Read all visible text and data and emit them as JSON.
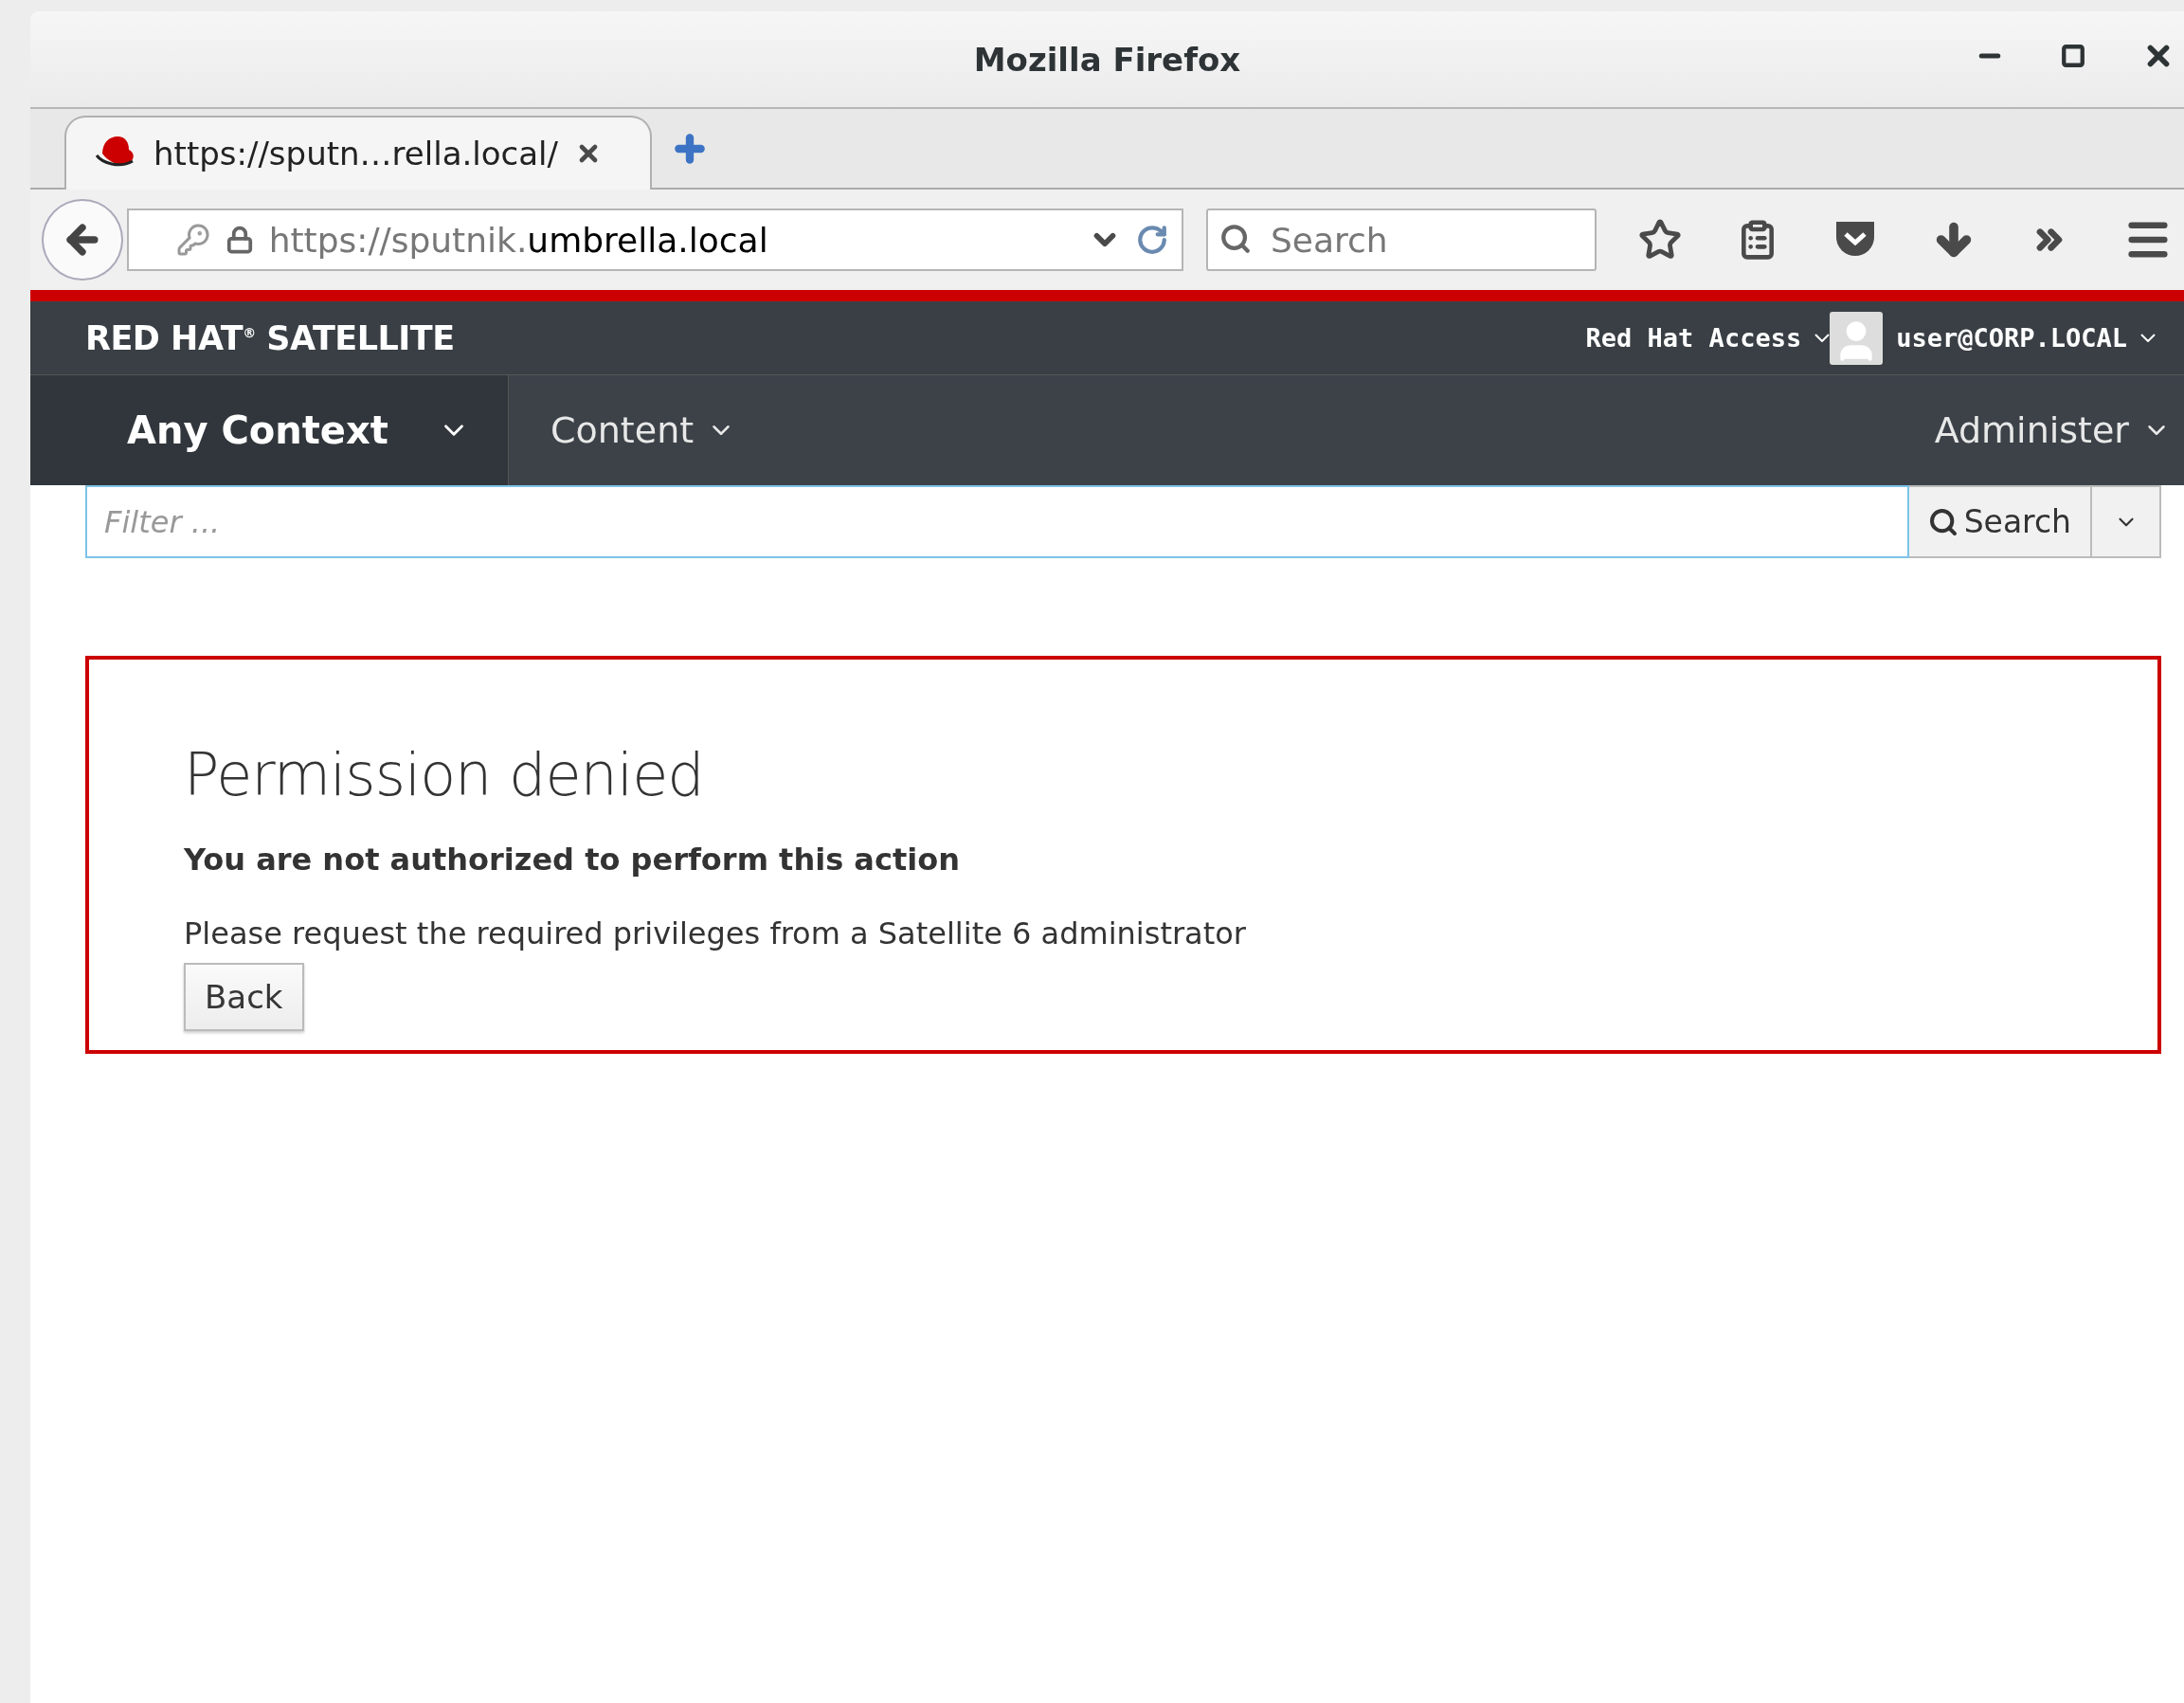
{
  "window": {
    "title": "Mozilla Firefox"
  },
  "tabs": [
    {
      "label": "https://sputn…rella.local/",
      "selected": true
    }
  ],
  "address_bar": {
    "prefix": "https://sputnik.",
    "host": "umbrella.local"
  },
  "browser_search": {
    "placeholder": "Search"
  },
  "header": {
    "brand": "RED HAT$^{®}$ SATELLITE",
    "help_menu": "Red Hat Access",
    "user_menu": "user@CORP.LOCAL"
  },
  "nav": {
    "context": "Any Context",
    "left_items": [
      "Content"
    ],
    "right_items": [
      "Administer"
    ]
  },
  "filter": {
    "placeholder": "Filter ...",
    "button": "Search"
  },
  "error": {
    "title": "Permission denied",
    "subtitle": "You are not authorized to perform this action",
    "message": "Please request the required privileges from a Satellite 6 administrator",
    "button": "Back"
  }
}
